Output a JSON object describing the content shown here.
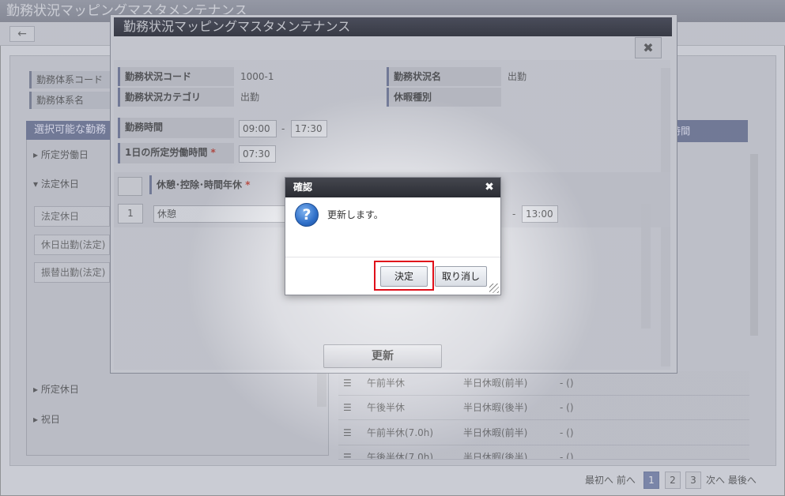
{
  "background": {
    "window_title": "勤務状況マッピングマスタメンテナンス",
    "labels": {
      "system_code": "勤務体系コード",
      "system_name": "勤務体系名"
    },
    "section_header": "選択可能な勤務",
    "tree": {
      "scheduled_workday": "所定労働日",
      "legal_holiday": "法定休日",
      "scheduled_holiday": "所定休日",
      "public_holiday": "祝日"
    },
    "chips": [
      "法定休日",
      "休日出勤(法定)",
      "振替出勤(法定)"
    ],
    "right_header": "休暇時間",
    "rows": [
      {
        "name": "午前半休",
        "type": "半日休暇(前半)",
        "time": "- ()"
      },
      {
        "name": "午後半休",
        "type": "半日休暇(後半)",
        "time": "- ()"
      },
      {
        "name": "午前半休(7.0h)",
        "type": "半日休暇(前半)",
        "time": "- ()"
      },
      {
        "name": "午後半休(7.0h)",
        "type": "半日休暇(後半)",
        "time": "- ()"
      }
    ],
    "pager": {
      "first_prev": "最初へ 前へ",
      "pages": [
        "1",
        "2",
        "3"
      ],
      "next_last": "次へ 最後へ"
    }
  },
  "edit_dialog": {
    "title": "勤務状況マッピングマスタメンテナンス",
    "close_glyph": "✖",
    "fields": {
      "status_code_label": "勤務状況コード",
      "status_code_value": "1000-1",
      "status_name_label": "勤務状況名",
      "status_name_value": "出勤",
      "status_category_label": "勤務状況カテゴリ",
      "status_category_value": "出勤",
      "leave_type_label": "休暇種別",
      "work_time_label": "勤務時間",
      "work_time_start": "09:00",
      "work_time_end": "17:30",
      "daily_hours_label": "1日の所定労働時間",
      "daily_hours_value": "07:30",
      "break_label": "休憩･控除･時間年休",
      "break_row_no": "1",
      "break_row_name": "休憩",
      "break_row_end": "13:00",
      "required_mark": "*",
      "dash": "-"
    },
    "update_button": "更新"
  },
  "confirm_dialog": {
    "title": "確認",
    "close_glyph": "✖",
    "icon_glyph": "?",
    "message": "更新します。",
    "ok_label": "決定",
    "cancel_label": "取り消し",
    "highlight_color": "#e0101a"
  }
}
